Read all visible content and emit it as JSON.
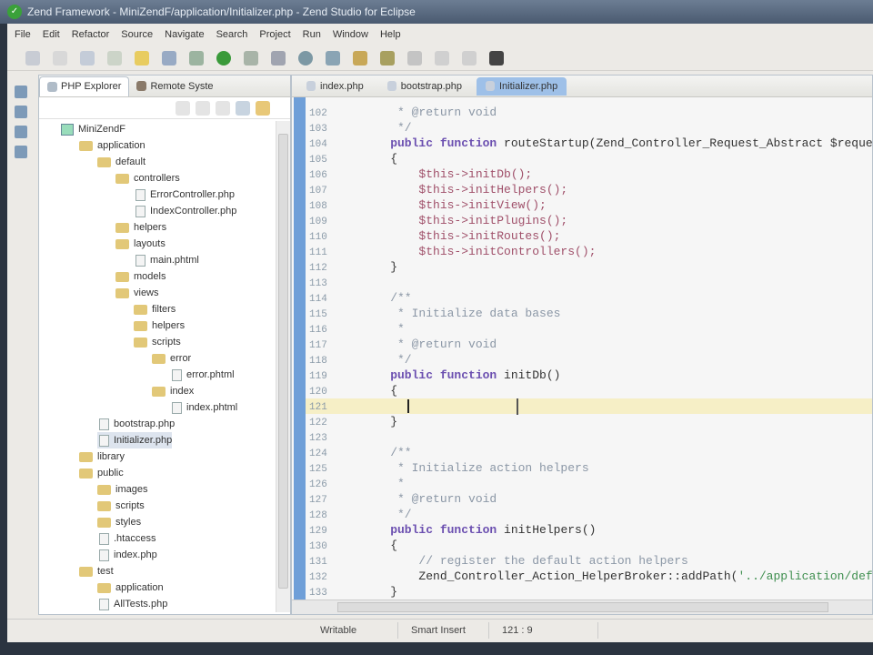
{
  "window": {
    "title": "Zend Framework - MiniZendF/application/Initializer.php - Zend Studio for Eclipse"
  },
  "menu": [
    "File",
    "Edit",
    "Refactor",
    "Source",
    "Navigate",
    "Search",
    "Project",
    "Run",
    "Window",
    "Help"
  ],
  "explorer": {
    "tabs": [
      {
        "label": "PHP Explorer",
        "icon": "php-explorer-icon"
      },
      {
        "label": "Remote Syste",
        "icon": "remote-systems-icon"
      }
    ],
    "tree": [
      {
        "label": "MiniZendF",
        "type": "project",
        "level": 0
      },
      {
        "label": "application",
        "type": "folder",
        "level": 1
      },
      {
        "label": "default",
        "type": "folder",
        "level": 2
      },
      {
        "label": "controllers",
        "type": "folder",
        "level": 3
      },
      {
        "label": "ErrorController.php",
        "type": "file",
        "level": 4
      },
      {
        "label": "IndexController.php",
        "type": "file",
        "level": 4
      },
      {
        "label": "helpers",
        "type": "folder",
        "level": 3
      },
      {
        "label": "layouts",
        "type": "folder",
        "level": 3
      },
      {
        "label": "main.phtml",
        "type": "file",
        "level": 4
      },
      {
        "label": "models",
        "type": "folder",
        "level": 3
      },
      {
        "label": "views",
        "type": "folder",
        "level": 3
      },
      {
        "label": "filters",
        "type": "folder",
        "level": 4
      },
      {
        "label": "helpers",
        "type": "folder",
        "level": 4
      },
      {
        "label": "scripts",
        "type": "folder",
        "level": 4
      },
      {
        "label": "error",
        "type": "folder",
        "level": 5
      },
      {
        "label": "error.phtml",
        "type": "file",
        "level": 6
      },
      {
        "label": "index",
        "type": "folder",
        "level": 5
      },
      {
        "label": "index.phtml",
        "type": "file",
        "level": 6
      },
      {
        "label": "bootstrap.php",
        "type": "file",
        "level": 2
      },
      {
        "label": "Initializer.php",
        "type": "file",
        "level": 2
      },
      {
        "label": "library",
        "type": "folder",
        "level": 1
      },
      {
        "label": "public",
        "type": "folder",
        "level": 1
      },
      {
        "label": "images",
        "type": "folder",
        "level": 2
      },
      {
        "label": "scripts",
        "type": "folder",
        "level": 2
      },
      {
        "label": "styles",
        "type": "folder",
        "level": 2
      },
      {
        "label": ".htaccess",
        "type": "file",
        "level": 2
      },
      {
        "label": "index.php",
        "type": "file",
        "level": 2
      },
      {
        "label": "test",
        "type": "folder",
        "level": 1
      },
      {
        "label": "application",
        "type": "folder",
        "level": 2
      },
      {
        "label": "AllTests.php",
        "type": "file",
        "level": 2
      }
    ]
  },
  "editor": {
    "tabs": [
      {
        "label": "index.php",
        "active": false
      },
      {
        "label": "bootstrap.php",
        "active": false
      },
      {
        "label": "Initializer.php",
        "active": true
      }
    ],
    "current_line": 121,
    "lines": [
      {
        "n": "102",
        "s": [
          [
            "cm",
            "     * @return void"
          ]
        ]
      },
      {
        "n": "103",
        "s": [
          [
            "cm",
            "     */"
          ]
        ]
      },
      {
        "n": "104",
        "s": [
          [
            "kw",
            "    public function "
          ],
          [
            "tx",
            "routeStartup(Zend_Controller_Request_Abstract $request)"
          ]
        ]
      },
      {
        "n": "105",
        "s": [
          [
            "tx",
            "    {"
          ]
        ]
      },
      {
        "n": "106",
        "s": [
          [
            "vr",
            "        $this->initDb();"
          ]
        ]
      },
      {
        "n": "107",
        "s": [
          [
            "vr",
            "        $this->initHelpers();"
          ]
        ]
      },
      {
        "n": "108",
        "s": [
          [
            "vr",
            "        $this->initView();"
          ]
        ]
      },
      {
        "n": "109",
        "s": [
          [
            "vr",
            "        $this->initPlugins();"
          ]
        ]
      },
      {
        "n": "110",
        "s": [
          [
            "vr",
            "        $this->initRoutes();"
          ]
        ]
      },
      {
        "n": "111",
        "s": [
          [
            "vr",
            "        $this->initControllers();"
          ]
        ]
      },
      {
        "n": "112",
        "s": [
          [
            "tx",
            "    }"
          ]
        ]
      },
      {
        "n": "113",
        "s": []
      },
      {
        "n": "114",
        "s": [
          [
            "cm",
            "    /**"
          ]
        ]
      },
      {
        "n": "115",
        "s": [
          [
            "cm",
            "     * Initialize data bases"
          ]
        ]
      },
      {
        "n": "116",
        "s": [
          [
            "cm",
            "     *"
          ]
        ]
      },
      {
        "n": "117",
        "s": [
          [
            "cm",
            "     * @return void"
          ]
        ]
      },
      {
        "n": "118",
        "s": [
          [
            "cm",
            "     */"
          ]
        ]
      },
      {
        "n": "119",
        "s": [
          [
            "kw",
            "    public function "
          ],
          [
            "tx",
            "initDb()"
          ]
        ]
      },
      {
        "n": "120",
        "s": [
          [
            "tx",
            "    {"
          ]
        ]
      },
      {
        "n": "121",
        "s": []
      },
      {
        "n": "122",
        "s": [
          [
            "tx",
            "    }"
          ]
        ]
      },
      {
        "n": "123",
        "s": []
      },
      {
        "n": "124",
        "s": [
          [
            "cm",
            "    /**"
          ]
        ]
      },
      {
        "n": "125",
        "s": [
          [
            "cm",
            "     * Initialize action helpers"
          ]
        ]
      },
      {
        "n": "126",
        "s": [
          [
            "cm",
            "     *"
          ]
        ]
      },
      {
        "n": "127",
        "s": [
          [
            "cm",
            "     * @return void"
          ]
        ]
      },
      {
        "n": "128",
        "s": [
          [
            "cm",
            "     */"
          ]
        ]
      },
      {
        "n": "129",
        "s": [
          [
            "kw",
            "    public function "
          ],
          [
            "tx",
            "initHelpers()"
          ]
        ]
      },
      {
        "n": "130",
        "s": [
          [
            "tx",
            "    {"
          ]
        ]
      },
      {
        "n": "131",
        "s": [
          [
            "cm",
            "        // register the default action helpers"
          ]
        ]
      },
      {
        "n": "132",
        "s": [
          [
            "tx",
            "        Zend_Controller_Action_HelperBroker::addPath("
          ],
          [
            "st",
            "'../application/default/helpers'"
          ]
        ]
      },
      {
        "n": "133",
        "s": [
          [
            "tx",
            "    }"
          ]
        ]
      }
    ]
  },
  "status": {
    "mode": "Writable",
    "insert": "Smart Insert",
    "position": "121 : 9"
  }
}
